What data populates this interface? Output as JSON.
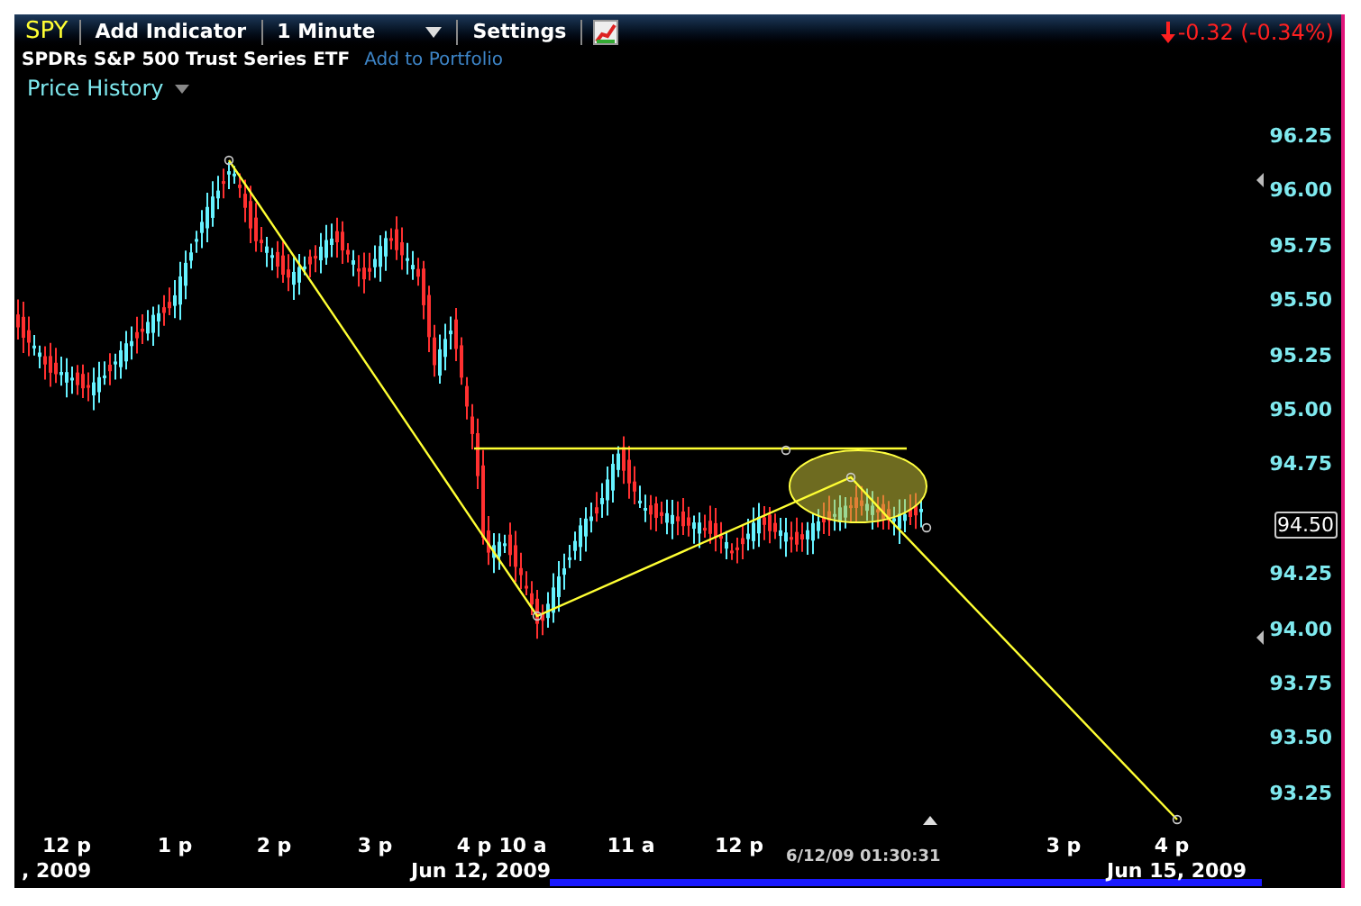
{
  "toolbar": {
    "symbol": "SPY",
    "items": [
      "Add Indicator",
      "1 Minute",
      "Settings"
    ],
    "change": "-0.32 (-0.34%)"
  },
  "subtitle": {
    "name": "SPDRs S&P 500 Trust Series ETF",
    "link": "Add to Portfolio"
  },
  "panel": {
    "title": "Price History"
  },
  "y_axis_labels": [
    "96.25",
    "96.00",
    "95.75",
    "95.50",
    "95.25",
    "95.00",
    "94.75",
    "94.25",
    "94.00",
    "93.75",
    "93.50",
    "93.25"
  ],
  "current_price": "94.50",
  "x_axis_labels": [
    "12 p",
    "1 p",
    "2 p",
    "3 p",
    "4 p",
    "10 a",
    "11 a",
    "12 p",
    "3 p",
    "4 p"
  ],
  "timestamp": "6/12/09 01:30:31",
  "date_labels": [
    ", 2009",
    "Jun 12, 2009",
    "Jun 15, 2009"
  ]
}
